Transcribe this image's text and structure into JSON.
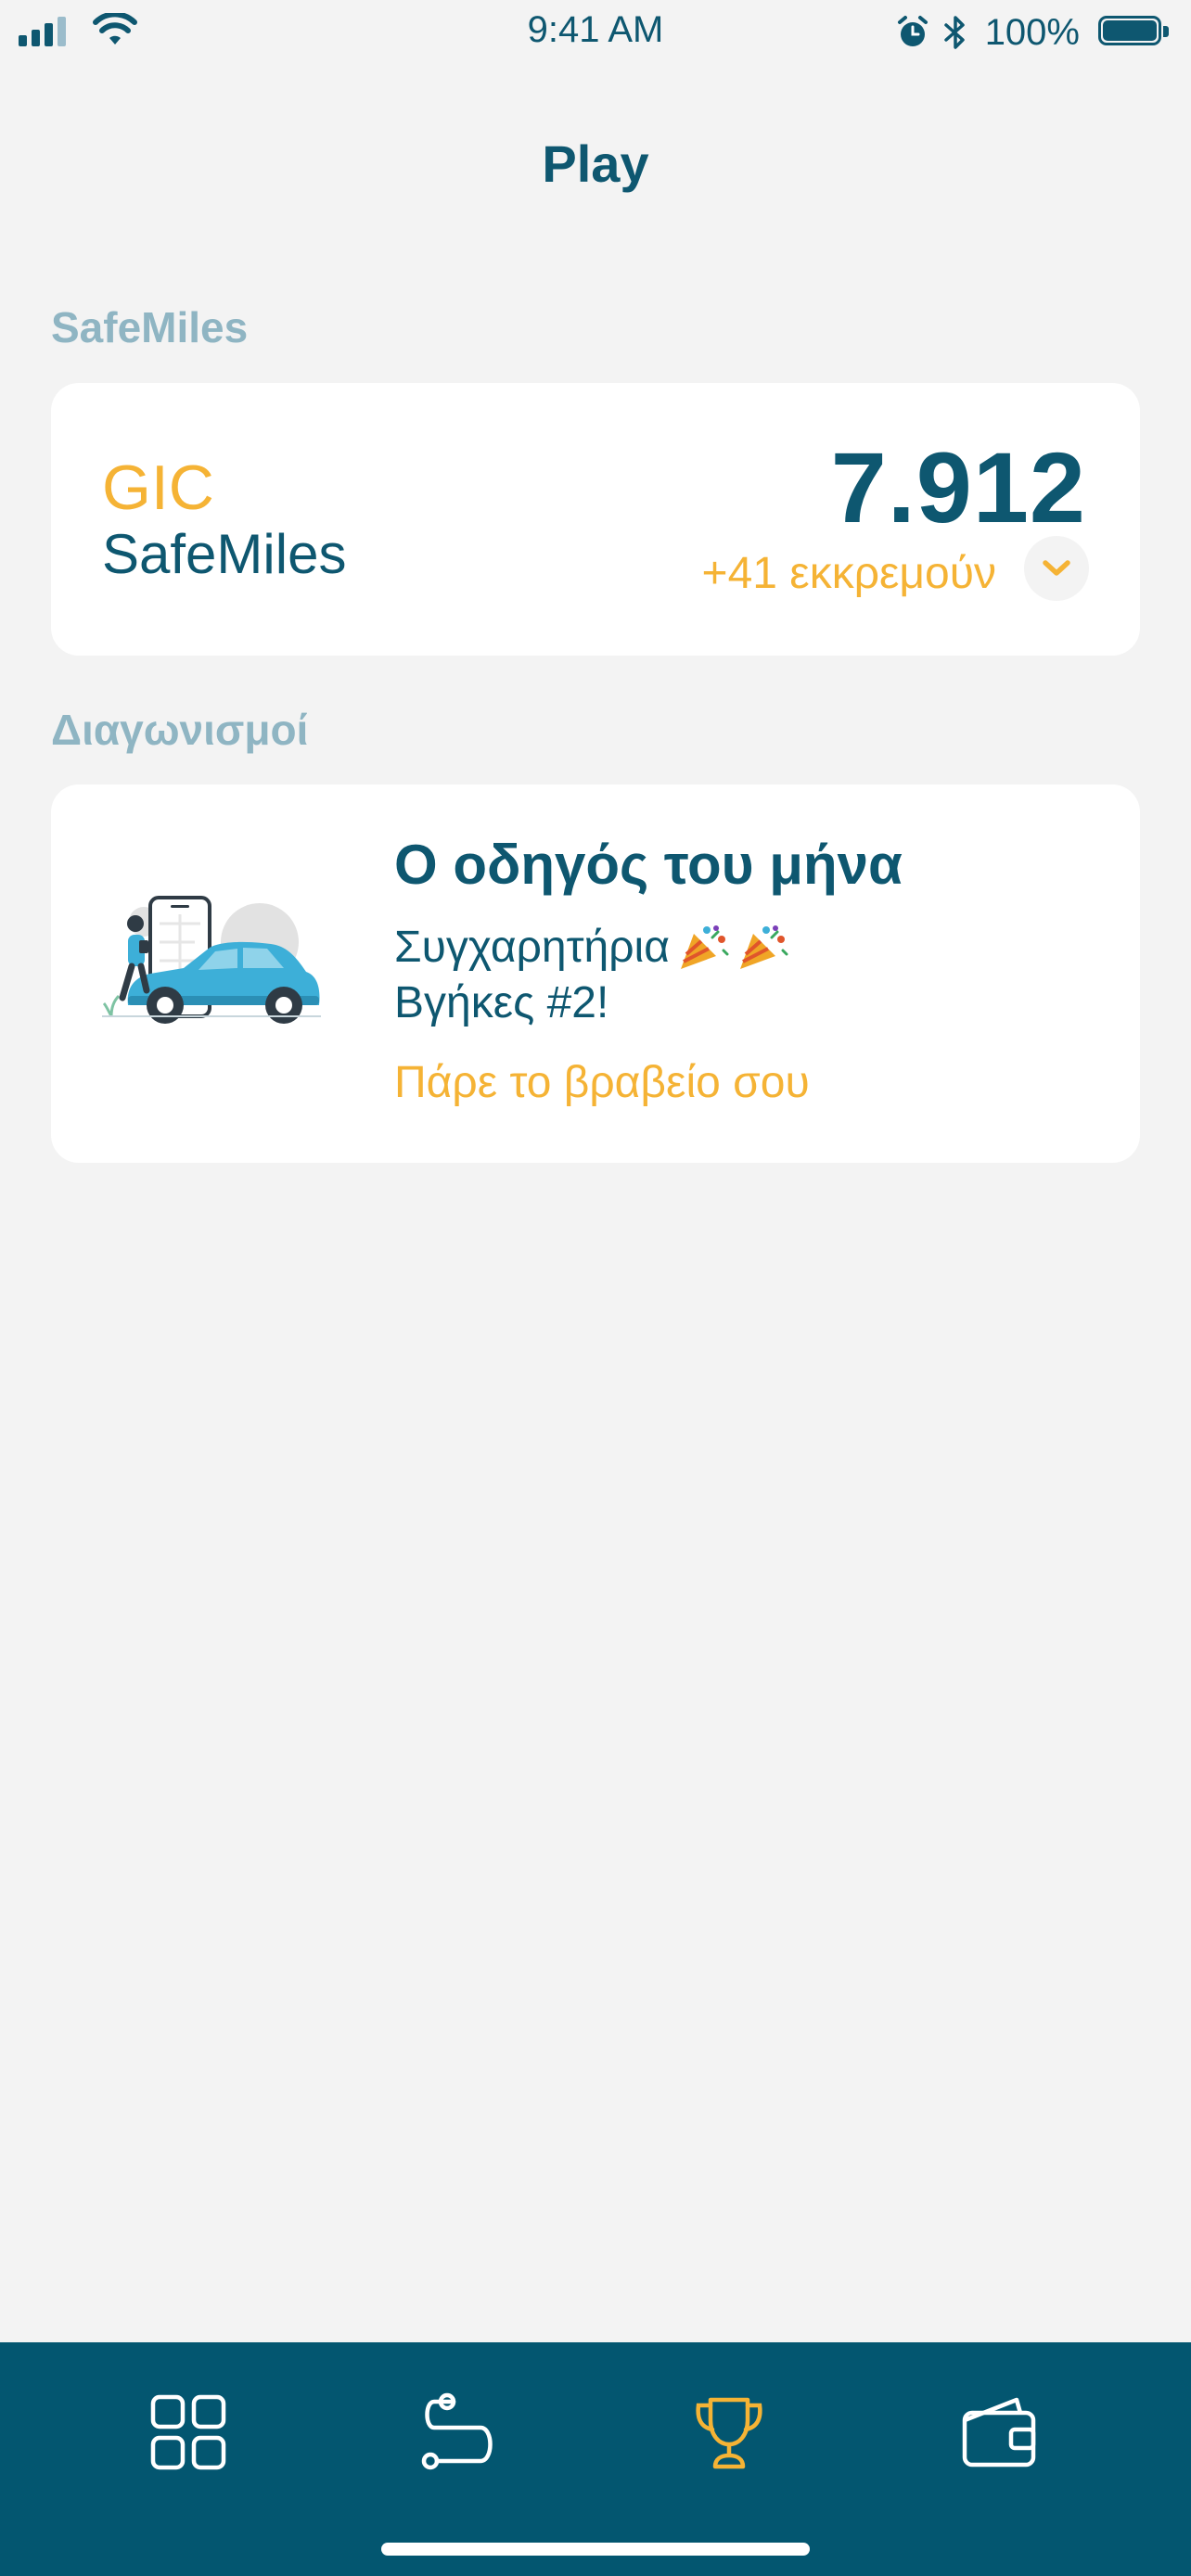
{
  "status_bar": {
    "time": "9:41 AM",
    "battery_percent": "100%",
    "signal_icon": "cellular-signal-icon",
    "wifi_icon": "wifi-icon",
    "alarm_icon": "alarm-icon",
    "bluetooth_icon": "bluetooth-icon",
    "battery_icon": "battery-icon"
  },
  "header": {
    "title": "Play"
  },
  "safemiles": {
    "section_label": "SafeMiles",
    "brand": "GIC",
    "name": "SafeMiles",
    "points": "7.912",
    "pending": "+41 εκκρεμούν",
    "expand_icon": "chevron-down-icon"
  },
  "contests": {
    "section_label": "Διαγωνισμοί",
    "card": {
      "title": "Ο οδηγός του μήνα",
      "line1": "Συγχαρητήρια",
      "line2": "Βγήκες #2!",
      "cta": "Πάρε το βραβείο σου",
      "illustration": "car-with-driver-illustration",
      "emoji_icon": "party-popper-icon"
    }
  },
  "tab_bar": {
    "tabs": [
      {
        "icon": "dashboard-grid-icon",
        "active": false
      },
      {
        "icon": "route-icon",
        "active": false
      },
      {
        "icon": "trophy-icon",
        "active": true
      },
      {
        "icon": "wallet-icon",
        "active": false
      }
    ]
  },
  "colors": {
    "primary": "#0e5770",
    "accent": "#f5b335",
    "section_label": "#8fb5c3",
    "tab_bar_bg": "#035670",
    "background": "#f3f3f3"
  }
}
